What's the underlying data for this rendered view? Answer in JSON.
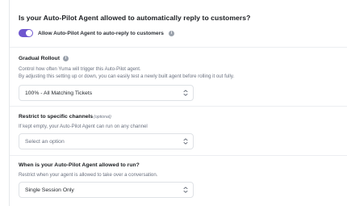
{
  "autoreply": {
    "question": "Is your Auto-Pilot Agent allowed to automatically reply to customers?",
    "toggle_label": "Allow Auto-Pilot Agent to auto-reply to customers",
    "toggle_on": true
  },
  "rollout": {
    "title": "Gradual Rollout",
    "desc_line1": "Control how often Yuma will trigger this Auto-Pilot agent.",
    "desc_line2": "By adjusting this setting up or down, you can easily test a newly built agent before rolling it out fully.",
    "selected": "100% - All Matching Tickets"
  },
  "channels": {
    "title": "Restrict to specific channels",
    "optional_label": "(optional)",
    "desc": "If kept empty, your Auto-Pilot Agent can run on any channel",
    "placeholder": "Select an option"
  },
  "run": {
    "title": "When is your Auto-Pilot Agent allowed to run?",
    "desc": "Restrict when your agent is allowed to take over a conversation.",
    "selected": "Single Session Only"
  },
  "colors": {
    "accent": "#6e56cf",
    "muted_text": "#6b7280"
  },
  "icons": {
    "info": "info-icon",
    "select_chevron": "chevron-up-down-icon"
  }
}
